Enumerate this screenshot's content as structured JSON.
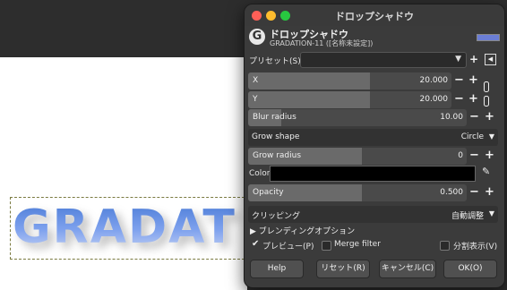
{
  "canvas": {
    "text": "GRADAT"
  },
  "dialog": {
    "title": "ドロップシャドウ",
    "header": {
      "icon_letter": "G",
      "title": "ドロップシャドウ",
      "subtitle": "GRADATION-11 ([名称未設定])"
    },
    "preset": {
      "label": "プリセット(S):",
      "value": ""
    },
    "x": {
      "label": "X",
      "value": "20.000",
      "fill_fraction": 0.6
    },
    "y": {
      "label": "Y",
      "value": "20.000",
      "fill_fraction": 0.6
    },
    "blur": {
      "label": "Blur radius",
      "value": "10.00",
      "fill_fraction": 0.15
    },
    "grow_shape": {
      "label": "Grow shape",
      "value": "Circle"
    },
    "grow_radius": {
      "label": "Grow radius",
      "value": "0",
      "fill_fraction": 0.52
    },
    "color": {
      "label": "Color",
      "value": "#000000"
    },
    "opacity": {
      "label": "Opacity",
      "value": "0.500",
      "fill_fraction": 0.52
    },
    "clipping": {
      "label": "クリッピング",
      "value": "自動調整"
    },
    "blending": {
      "label": "ブレンディングオプション"
    },
    "preview": {
      "label": "プレビュー(P)",
      "checked": true
    },
    "merge_filter": {
      "label": "Merge filter",
      "checked": false
    },
    "split_view": {
      "label": "分割表示(V)",
      "checked": false
    },
    "buttons": {
      "help": "Help",
      "reset": "リセット(R)",
      "cancel": "キャンセル(C)",
      "ok": "OK(O)"
    }
  },
  "colors": {
    "traffic_close": "#ff5f57",
    "traffic_min": "#febc2e",
    "traffic_max": "#28c840"
  }
}
